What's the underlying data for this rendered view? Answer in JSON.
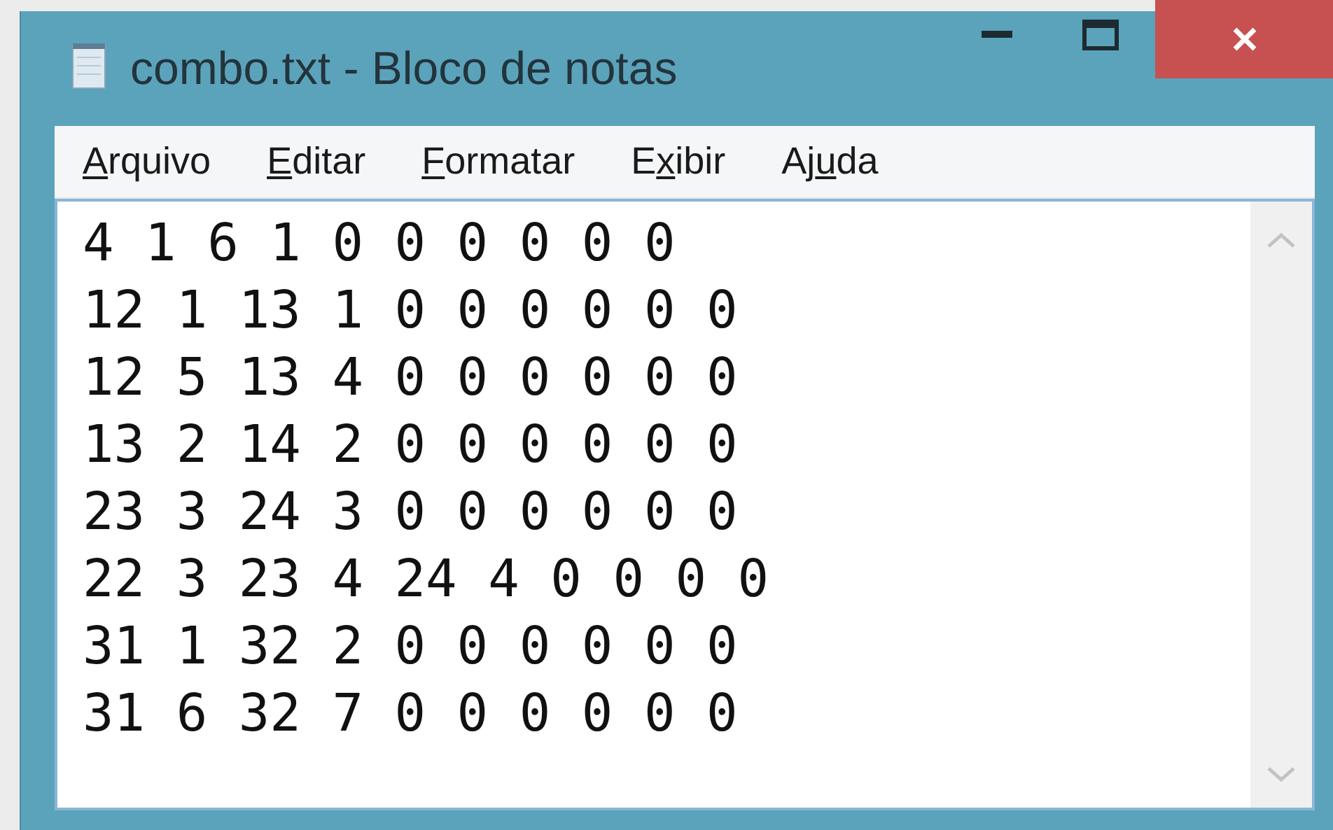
{
  "window": {
    "title": "combo.txt - Bloco de notas"
  },
  "menu": [
    {
      "key": "A",
      "after": "rquivo"
    },
    {
      "key": "E",
      "after": "ditar"
    },
    {
      "key": "F",
      "after": "ormatar"
    },
    {
      "before": "E",
      "key": "x",
      "after": "ibir"
    },
    {
      "before": "Aj",
      "key": "u",
      "after": "da"
    }
  ],
  "lines": [
    "4 1 6 1 0 0 0 0 0 0",
    "12 1 13 1 0 0 0 0 0 0",
    "12 5 13 4 0 0 0 0 0 0",
    "13 2 14 2 0 0 0 0 0 0",
    "23 3 24 3 0 0 0 0 0 0",
    "22 3 23 4 24 4 0 0 0 0",
    "31 1 32 2 0 0 0 0 0 0",
    "31 6 32 7 0 0 0 0 0 0"
  ]
}
